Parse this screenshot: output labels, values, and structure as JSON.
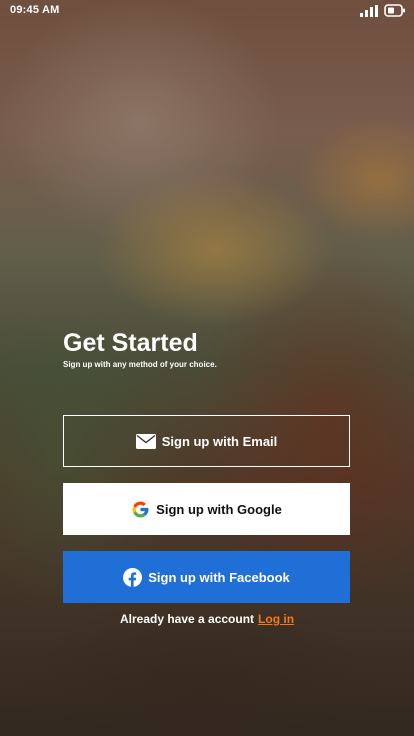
{
  "status_bar": {
    "time": "09:45 AM",
    "signal_icon": "signal-icon",
    "battery_icon": "battery-icon"
  },
  "hero": {
    "title": "Get Started",
    "subtitle": "Sign up with any method of your choice."
  },
  "buttons": {
    "email": {
      "label": "Sign up with Email",
      "icon": "envelope-icon"
    },
    "google": {
      "label": "Sign up with Google",
      "icon": "google-icon"
    },
    "facebook": {
      "label": "Sign up with Facebook",
      "icon": "facebook-icon",
      "color": "#1f6fd6"
    }
  },
  "footer": {
    "prompt": "Already have a account",
    "login_label": "Log in",
    "login_color": "#f07a22"
  }
}
